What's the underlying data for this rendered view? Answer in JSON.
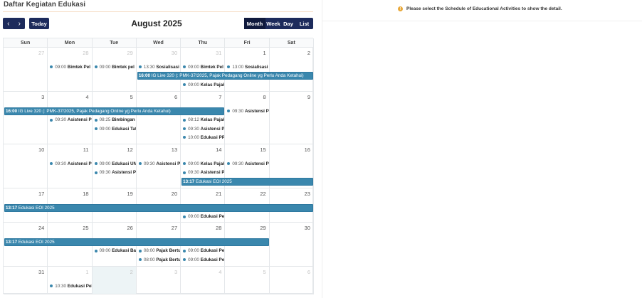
{
  "page_title": "Daftar Kegiatan Edukasi",
  "toolbar": {
    "prev": "‹",
    "next": "›",
    "today": "Today",
    "title": "August 2025",
    "views": [
      "Month",
      "Week",
      "Day",
      "List"
    ],
    "active_view": "Month"
  },
  "weekdays": [
    "Sun",
    "Mon",
    "Tue",
    "Wed",
    "Thu",
    "Fri",
    "Sat"
  ],
  "today_date": "2025-09-02",
  "colors": {
    "primary": "#1d2b5c",
    "event": "#3a87ad",
    "today_bg": "#edf4f6",
    "info": "#e8a93c"
  },
  "weeks": [
    {
      "days": [
        {
          "n": "27",
          "other": true
        },
        {
          "n": "28",
          "other": true
        },
        {
          "n": "29",
          "other": true
        },
        {
          "n": "30",
          "other": true
        },
        {
          "n": "31",
          "other": true
        },
        {
          "n": "1"
        },
        {
          "n": "2"
        }
      ],
      "bars": [
        {
          "col": 3,
          "span": 4,
          "slot": 1,
          "time": "16:00",
          "title": "IG Live 320 (: PMK-37/2025, Pajak Pedagang Online yg Perlu Anda Ketahui)"
        }
      ],
      "events": [
        {
          "col": 1,
          "slot": 0,
          "time": "09:00",
          "title": "Bimtek Pel"
        },
        {
          "col": 2,
          "slot": 0,
          "time": "09:00",
          "title": "Bimtek pel"
        },
        {
          "col": 3,
          "slot": 0,
          "time": "13:30",
          "title": "Sosialisasi I"
        },
        {
          "col": 4,
          "slot": 0,
          "time": "09:00",
          "title": "Bimtek Pel"
        },
        {
          "col": 5,
          "slot": 0,
          "time": "13:00",
          "title": "Sosialisasi I"
        },
        {
          "col": 4,
          "slot": 2,
          "time": "09:00",
          "title": "Kelas Pajak"
        }
      ]
    },
    {
      "days": [
        {
          "n": "3"
        },
        {
          "n": "4"
        },
        {
          "n": "5"
        },
        {
          "n": "6"
        },
        {
          "n": "7"
        },
        {
          "n": "8"
        },
        {
          "n": "9"
        }
      ],
      "bars": [
        {
          "col": 0,
          "span": 5,
          "slot": 0,
          "time": "16:00",
          "title": "IG Live 320 (: PMK-37/2025, Pajak Pedagang Online yg Perlu Anda Ketahui)"
        }
      ],
      "events": [
        {
          "col": 5,
          "slot": 0,
          "time": "09:30",
          "title": "Asistensi Pe"
        },
        {
          "col": 1,
          "slot": 1,
          "time": "09:30",
          "title": "Asistensi Pe"
        },
        {
          "col": 2,
          "slot": 1,
          "time": "08:25",
          "title": "Bimbingan"
        },
        {
          "col": 2,
          "slot": 2,
          "time": "09:00",
          "title": "Edukasi Tat"
        },
        {
          "col": 4,
          "slot": 1,
          "time": "08:12",
          "title": "Kelas Pajak"
        },
        {
          "col": 4,
          "slot": 2,
          "time": "09:30",
          "title": "Asistensi Pe"
        },
        {
          "col": 4,
          "slot": 3,
          "time": "10:00",
          "title": "Edukasi PPI"
        }
      ]
    },
    {
      "days": [
        {
          "n": "10"
        },
        {
          "n": "11"
        },
        {
          "n": "12"
        },
        {
          "n": "13"
        },
        {
          "n": "14"
        },
        {
          "n": "15"
        },
        {
          "n": "16"
        }
      ],
      "bars": [
        {
          "col": 4,
          "span": 3,
          "slot": 2,
          "time": "13:17",
          "title": "Edukasi EOI 2025"
        }
      ],
      "events": [
        {
          "col": 1,
          "slot": 0,
          "time": "09:30",
          "title": "Asistensi Pe"
        },
        {
          "col": 2,
          "slot": 0,
          "time": "09:00",
          "title": "Edukasi UN"
        },
        {
          "col": 3,
          "slot": 0,
          "time": "09:30",
          "title": "Asistensi Pe"
        },
        {
          "col": 4,
          "slot": 0,
          "time": "09:00",
          "title": "Kelas Pajak"
        },
        {
          "col": 5,
          "slot": 0,
          "time": "09:30",
          "title": "Asistensi Pe"
        },
        {
          "col": 2,
          "slot": 1,
          "time": "09:30",
          "title": "Asistensi Pe"
        },
        {
          "col": 4,
          "slot": 1,
          "time": "09:30",
          "title": "Asistensi Pe"
        }
      ]
    },
    {
      "days": [
        {
          "n": "17"
        },
        {
          "n": "18"
        },
        {
          "n": "19"
        },
        {
          "n": "20"
        },
        {
          "n": "21"
        },
        {
          "n": "22"
        },
        {
          "n": "23"
        }
      ],
      "bars": [
        {
          "col": 0,
          "span": 7,
          "slot": 0,
          "time": "13:17",
          "title": "Edukasi EOI 2025"
        }
      ],
      "events": [
        {
          "col": 4,
          "slot": 1,
          "time": "09:00",
          "title": "Edukasi Per"
        }
      ]
    },
    {
      "days": [
        {
          "n": "24"
        },
        {
          "n": "25"
        },
        {
          "n": "26"
        },
        {
          "n": "27"
        },
        {
          "n": "28"
        },
        {
          "n": "29"
        },
        {
          "n": "30"
        }
      ],
      "bars": [
        {
          "col": 0,
          "span": 6,
          "slot": 0,
          "time": "13:17",
          "title": "Edukasi EOI 2025"
        }
      ],
      "events": [
        {
          "col": 2,
          "slot": 1,
          "time": "09:00",
          "title": "Edukasi Bag"
        },
        {
          "col": 3,
          "slot": 1,
          "time": "08:00",
          "title": "Pajak Bertu"
        },
        {
          "col": 4,
          "slot": 1,
          "time": "09:00",
          "title": "Edukasi Pel"
        },
        {
          "col": 3,
          "slot": 2,
          "time": "08:00",
          "title": "Pajak Bertu"
        },
        {
          "col": 4,
          "slot": 2,
          "time": "09:00",
          "title": "Edukasi Per"
        }
      ]
    },
    {
      "days": [
        {
          "n": "31"
        },
        {
          "n": "1",
          "other": true
        },
        {
          "n": "2",
          "other": true,
          "today": true
        },
        {
          "n": "3",
          "other": true
        },
        {
          "n": "4",
          "other": true
        },
        {
          "n": "5",
          "other": true
        },
        {
          "n": "6",
          "other": true
        }
      ],
      "bars": [],
      "events": [
        {
          "col": 1,
          "slot": 0,
          "time": "10:30",
          "title": "Edukasi Pel"
        }
      ]
    }
  ],
  "detail": {
    "message": "Please select the Schedule of Educational Activities to show the detail.",
    "icon": "info-icon"
  }
}
